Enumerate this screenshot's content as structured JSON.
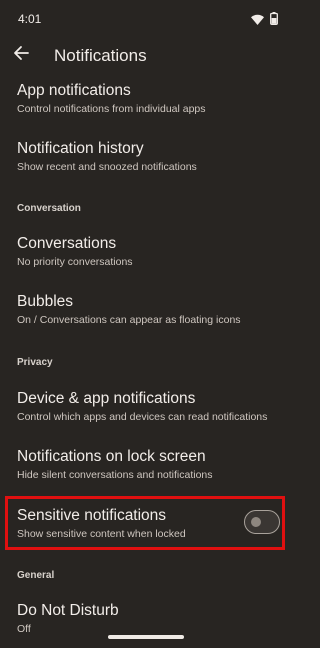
{
  "status_bar": {
    "time": "4:01",
    "icons": [
      "wifi-icon",
      "battery-icon"
    ]
  },
  "app_bar": {
    "title": "Notifications",
    "back_icon": "back-arrow-icon"
  },
  "items": [
    {
      "title": "App notifications",
      "subtitle": "Control notifications from individual apps"
    },
    {
      "title": "Notification history",
      "subtitle": "Show recent and snoozed notifications"
    },
    {
      "title": "Conversations",
      "subtitle": "No priority conversations"
    },
    {
      "title": "Bubbles",
      "subtitle": "On / Conversations can appear as floating icons"
    },
    {
      "title": "Device & app notifications",
      "subtitle": "Control which apps and devices can read notifications"
    },
    {
      "title": "Notifications on lock screen",
      "subtitle": "Hide silent conversations and notifications"
    },
    {
      "title": "Sensitive notifications",
      "subtitle": "Show sensitive content when locked",
      "toggle": false
    },
    {
      "title": "Do Not Disturb",
      "subtitle": "Off"
    }
  ],
  "sections": {
    "conversation": "Conversation",
    "privacy": "Privacy",
    "general": "General"
  },
  "colors": {
    "background": "#282522",
    "highlight": "#e01010"
  }
}
